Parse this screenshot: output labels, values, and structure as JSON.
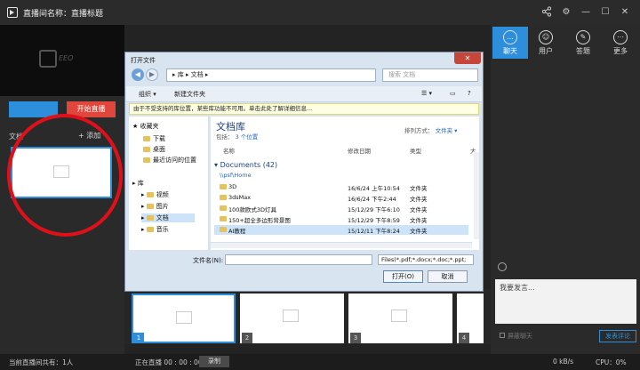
{
  "window": {
    "title": "直播间名称：直播标题",
    "controls": [
      "share-icon",
      "gear-icon",
      "minimize-icon",
      "maximize-icon",
      "close-icon"
    ]
  },
  "left": {
    "start_button": "开始直播",
    "doc_label": "文档",
    "add_label": "+ 添加"
  },
  "right": {
    "tabs": [
      {
        "label": "聊天",
        "icon": "chat-icon",
        "active": true
      },
      {
        "label": "用户",
        "icon": "users-icon",
        "active": false
      },
      {
        "label": "答题",
        "icon": "pen-icon",
        "active": false
      },
      {
        "label": "更多",
        "icon": "more-icon",
        "active": false
      }
    ],
    "chat_placeholder": "我要发言...",
    "shield_label": "屏蔽聊天",
    "send_label": "发表评论"
  },
  "slides": [
    "1",
    "2",
    "3",
    "4"
  ],
  "status": {
    "online": "当前直播间共有：1人",
    "live": "正在直播 00 : 00 : 00",
    "record": "录制",
    "speed": "0 kB/s",
    "cpu": "CPU：0%"
  },
  "dialog": {
    "title": "打开文件",
    "address": "▸ 库 ▸ 文档 ▸",
    "search_placeholder": "搜索 文档",
    "organize": "组织 ▾",
    "new_folder": "新建文件夹",
    "info": "由于不受支持的库位置，某些库功能不可用。单击此处了解详细信息...",
    "nav": {
      "favorites": "收藏夹",
      "downloads": "下载",
      "desktop": "桌面",
      "recent": "最近访问的位置",
      "library": "库",
      "videos": "视频",
      "pictures": "图片",
      "documents": "文档",
      "music": "音乐"
    },
    "library_title": "文档库",
    "library_includes": "包括：",
    "library_locations": "3 个位置",
    "arrange_label": "排列方式：",
    "arrange_value": "文件夹 ▾",
    "columns": {
      "name": "名称",
      "date": "修改日期",
      "type": "类型",
      "size": "大"
    },
    "group_title": "Documents (42)",
    "group_path": "\\\\psf\\Home",
    "files": [
      {
        "name": "3D",
        "date": "16/6/24 上午10:54",
        "type": "文件夹",
        "selected": false
      },
      {
        "name": "3dsMax",
        "date": "16/6/24 下午2:44",
        "type": "文件夹",
        "selected": false
      },
      {
        "name": "100款欧式3D灯具",
        "date": "15/12/29 下午6:10",
        "type": "文件夹",
        "selected": false
      },
      {
        "name": "150+超全多边形背景图",
        "date": "15/12/29 下午8:59",
        "type": "文件夹",
        "selected": false
      },
      {
        "name": "AI教程",
        "date": "15/12/11 下午8:24",
        "type": "文件夹",
        "selected": true
      }
    ],
    "filename_label": "文件名(N):",
    "filetype": "Files(*.pdf;*.docx;*.doc;*.ppt;",
    "open_label": "打开(O)",
    "cancel_label": "取消"
  }
}
